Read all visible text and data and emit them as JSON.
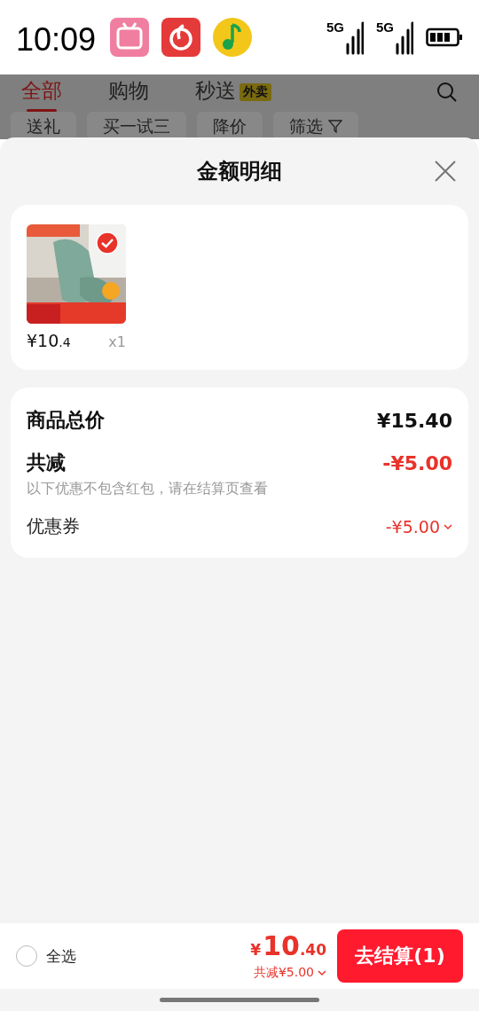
{
  "status_bar": {
    "time": "10:09",
    "networks": [
      "5G",
      "5G"
    ]
  },
  "background_page": {
    "tabs": [
      {
        "label": "全部",
        "selected": true
      },
      {
        "label": "购物",
        "selected": false
      },
      {
        "label": "秒送",
        "selected": false,
        "badge": "外卖"
      }
    ],
    "chips": [
      {
        "label": "送礼",
        "kind": "plain"
      },
      {
        "label": "买一试三",
        "kind": "plain"
      },
      {
        "label": "降价",
        "kind": "plain"
      },
      {
        "label": "筛选",
        "kind": "filter"
      }
    ]
  },
  "sheet": {
    "title": "金额明细",
    "items": [
      {
        "kind": "picture",
        "selected": true,
        "price": {
          "integer": "¥10",
          "decimal": ".4"
        },
        "quantity": "x1"
      }
    ],
    "summary": {
      "total_label": "商品总价",
      "total_value": "¥15.40",
      "reduction_label": "共减",
      "reduction_value": "-¥5.00",
      "reduction_note": "以下优惠不包含红包，请在结算页查看",
      "coupon_label": "优惠券",
      "coupon_value": "-¥5.00"
    }
  },
  "bottom_bar": {
    "select_all": {
      "label": "全选",
      "checked": false
    },
    "total": {
      "currency": "¥",
      "integer": "10",
      "decimal": ".40"
    },
    "reduction": "共减¥5.00",
    "checkout_button": "去结算(1)"
  }
}
